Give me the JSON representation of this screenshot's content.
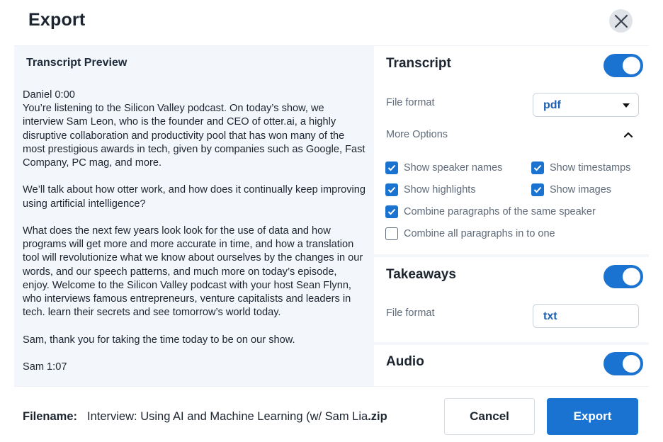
{
  "header": {
    "title": "Export",
    "close_icon": "close-icon"
  },
  "preview": {
    "title": "Transcript Preview",
    "paragraphs": [
      "Daniel  0:00",
      "You’re listening to the Silicon Valley podcast. On today’s show, we interview Sam Leon, who is the founder and CEO of otter.ai, a highly disruptive collaboration and productivity pool that has won many of the most prestigious awards in tech, given by companies such as Google, Fast Company, PC mag, and more.",
      "We’ll talk about how otter work, and how does it continually keep improving using artificial intelligence?",
      "What does the next few years look look for the use of data and how programs will get more and more accurate in time, and how a translation tool will revolutionize what we know about ourselves by the changes in our words, and our speech patterns, and much more on today’s episode, enjoy. Welcome to the Silicon Valley podcast with your host Sean Flynn, who interviews famous entrepreneurs, venture capitalists and leaders in tech. learn their secrets and see tomorrow’s world today.",
      "Sam, thank you for taking the time today to be on our show.",
      "Sam  1:07"
    ]
  },
  "transcript": {
    "title": "Transcript",
    "enabled": true,
    "file_format_label": "File format",
    "file_format_value": "pdf",
    "more_options_label": "More Options",
    "options": [
      {
        "label": "Show speaker names",
        "checked": true
      },
      {
        "label": "Show timestamps",
        "checked": true
      },
      {
        "label": "Show highlights",
        "checked": true
      },
      {
        "label": "Show images",
        "checked": true
      },
      {
        "label": "Combine paragraphs of the same speaker",
        "checked": true
      },
      {
        "label": "Combine all paragraphs in to one",
        "checked": false
      }
    ]
  },
  "takeaways": {
    "title": "Takeaways",
    "enabled": true,
    "file_format_label": "File format",
    "file_format_value": "txt"
  },
  "audio": {
    "title": "Audio",
    "enabled": true
  },
  "footer": {
    "filename_label": "Filename:",
    "filename_value": "Interview: Using AI and Machine Learning (w/ Sam Lia",
    "filename_ext": ".zip",
    "cancel_label": "Cancel",
    "export_label": "Export"
  },
  "colors": {
    "accent": "#1a73d1",
    "panel_bg": "#f3f6fa",
    "muted_text": "#5f6b7a"
  }
}
